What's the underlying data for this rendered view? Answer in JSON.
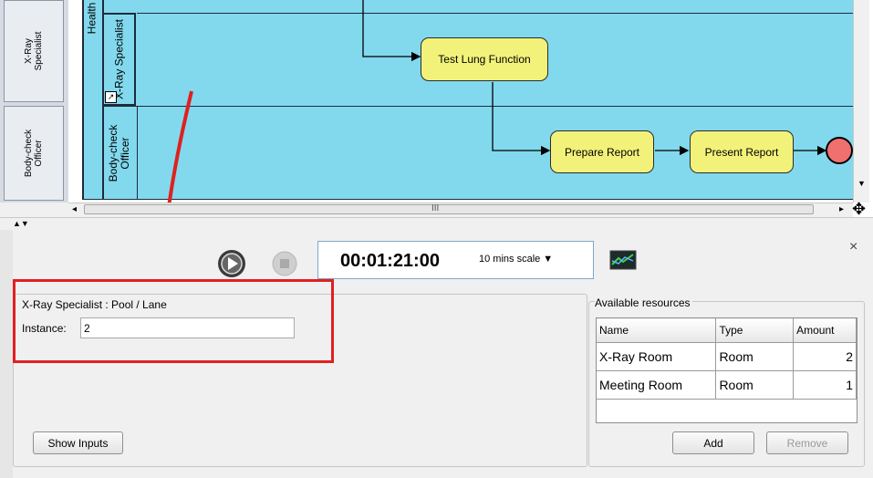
{
  "diagram": {
    "left_lanes": [
      "X-Ray Specialist",
      "Body-check Officer"
    ],
    "pool_label": "Health",
    "lanes": [
      "X-Ray Specialist",
      "Body-check Officer"
    ],
    "tasks": [
      "Test Lung Function",
      "Prepare Report",
      "Present Report"
    ],
    "scroll_grip": "III"
  },
  "simulation": {
    "time": "00:01:21:00",
    "scale": "10 mins scale ▼",
    "close": "×"
  },
  "properties": {
    "title": "X-Ray Specialist : Pool / Lane",
    "instance_label": "Instance:",
    "instance_value": "2",
    "show_inputs_label": "Show Inputs"
  },
  "resources": {
    "title": "Available resources",
    "columns": [
      "Name",
      "Type",
      "Amount"
    ],
    "rows": [
      {
        "name": "X-Ray Room",
        "type": "Room",
        "amount": "2"
      },
      {
        "name": "Meeting Room",
        "type": "Room",
        "amount": "1"
      }
    ],
    "add_label": "Add",
    "remove_label": "Remove"
  },
  "colors": {
    "pool": "#82d9ee",
    "task": "#f2f27a",
    "end_event": "#f07070",
    "highlight": "#e02020"
  }
}
